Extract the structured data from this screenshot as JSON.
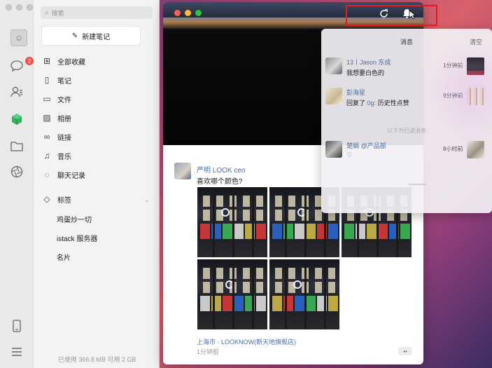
{
  "sidebar": {
    "search_placeholder": "搜索",
    "new_note_label": "新建笔记",
    "nav": [
      {
        "label": "全部收藏",
        "icon": "grid-icon"
      },
      {
        "label": "笔记",
        "icon": "notebook-icon"
      },
      {
        "label": "文件",
        "icon": "folder-icon"
      },
      {
        "label": "相册",
        "icon": "photo-icon"
      },
      {
        "label": "链接",
        "icon": "link-icon"
      },
      {
        "label": "音乐",
        "icon": "music-icon"
      },
      {
        "label": "聊天记录",
        "icon": "chat-history-icon"
      },
      {
        "label": "标签",
        "icon": "tag-icon"
      }
    ],
    "tags": [
      "鸡蛋炒一切",
      "istack 服务器",
      "名片"
    ],
    "storage": "已使用 366.8 MB 可用 2 GB"
  },
  "rail": {
    "chat_badge": "2",
    "icons": [
      "avatar",
      "chat-icon",
      "contacts-icon",
      "cube-icon",
      "folder-icon",
      "aperture-icon",
      "phone-icon",
      "menu-icon"
    ]
  },
  "post": {
    "author": "严明 LOOK ceo",
    "text": "喜欢哪个颜色?",
    "location": "上海市 · LOOKNOW(新天地旗舰店)",
    "time": "1分钟前",
    "more": "••"
  },
  "notifications": {
    "title": "消息",
    "clear": "清空",
    "read_divider": "以下为已读消息",
    "items": [
      {
        "who": "13丨Jason 东成",
        "msg": "我想要白色的",
        "highlight": "",
        "when": "1分钟前"
      },
      {
        "who": "彭海星",
        "msg_prefix": "回复了",
        "highlight": "0g:",
        "msg": "历史性点赞",
        "when": "9分钟前"
      },
      {
        "who": "楚娟 @产品部",
        "msg": "♡",
        "highlight": "",
        "when": "8小时前"
      }
    ]
  },
  "colors": {
    "link": "#4a6ea8",
    "badge": "#f0524b",
    "highlight_box": "#e8191d"
  }
}
